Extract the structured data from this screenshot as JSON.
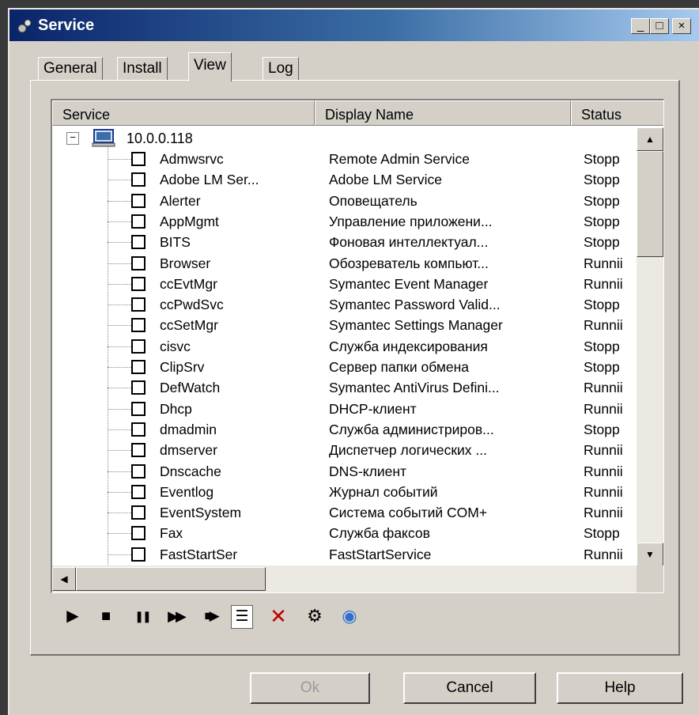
{
  "window": {
    "title": "Service"
  },
  "titlebar_buttons": {
    "minimize": "_",
    "maximize": "□",
    "close": "×"
  },
  "tabs": [
    {
      "label": "General",
      "active": false
    },
    {
      "label": "Install",
      "active": false
    },
    {
      "label": "View",
      "active": true
    },
    {
      "label": "Log",
      "active": false
    }
  ],
  "listview": {
    "columns": [
      "Service",
      "Display Name",
      "Status"
    ],
    "root": {
      "toggle": "−",
      "label": "10.0.0.118"
    },
    "rows": [
      {
        "service": "Admwsrvc",
        "display": "Remote Admin Service",
        "status": "Stopp"
      },
      {
        "service": "Adobe LM Ser...",
        "display": "Adobe LM Service",
        "status": "Stopp"
      },
      {
        "service": "Alerter",
        "display": "Оповещатель",
        "status": "Stopp"
      },
      {
        "service": "AppMgmt",
        "display": "Управление приложени...",
        "status": "Stopp"
      },
      {
        "service": "BITS",
        "display": "Фоновая интеллектуал...",
        "status": "Stopp"
      },
      {
        "service": "Browser",
        "display": "Обозреватель компьют...",
        "status": "Runnii"
      },
      {
        "service": "ccEvtMgr",
        "display": "Symantec Event Manager",
        "status": "Runnii"
      },
      {
        "service": "ccPwdSvc",
        "display": "Symantec Password Valid...",
        "status": "Stopp"
      },
      {
        "service": "ccSetMgr",
        "display": "Symantec Settings Manager",
        "status": "Runnii"
      },
      {
        "service": "cisvc",
        "display": "Служба индексирования",
        "status": "Stopp"
      },
      {
        "service": "ClipSrv",
        "display": "Сервер папки обмена",
        "status": "Stopp"
      },
      {
        "service": "DefWatch",
        "display": "Symantec AntiVirus Defini...",
        "status": "Runnii"
      },
      {
        "service": "Dhcp",
        "display": "DHCP-клиент",
        "status": "Runnii"
      },
      {
        "service": "dmadmin",
        "display": "Служба администриров...",
        "status": "Stopp"
      },
      {
        "service": "dmserver",
        "display": "Диспетчер логических ...",
        "status": "Runnii"
      },
      {
        "service": "Dnscache",
        "display": "DNS-клиент",
        "status": "Runnii"
      },
      {
        "service": "Eventlog",
        "display": "Журнал событий",
        "status": "Runnii"
      },
      {
        "service": "EventSystem",
        "display": "Система событий COM+",
        "status": "Runnii"
      },
      {
        "service": "Fax",
        "display": "Служба факсов",
        "status": "Stopp"
      },
      {
        "service": "FastStartSer",
        "display": "FastStartService",
        "status": "Runnii"
      }
    ]
  },
  "scrollbars": {
    "up": "▲",
    "down": "▼",
    "left": "◀",
    "right": "▶"
  },
  "toolbar": {
    "start": "▶",
    "stop": "■",
    "pause": "❚❚",
    "resume": "▶▶",
    "restart": "■▶",
    "properties": "☰",
    "delete": "✕",
    "settings": "⚙",
    "refresh": "◉"
  },
  "buttons": {
    "ok": "Ok",
    "cancel": "Cancel",
    "help": "Help"
  },
  "colors": {
    "title_bar": "#0a246a",
    "face": "#d4d0c8",
    "delete_icon": "#c00000",
    "refresh_icon": "#2f6fd0"
  }
}
